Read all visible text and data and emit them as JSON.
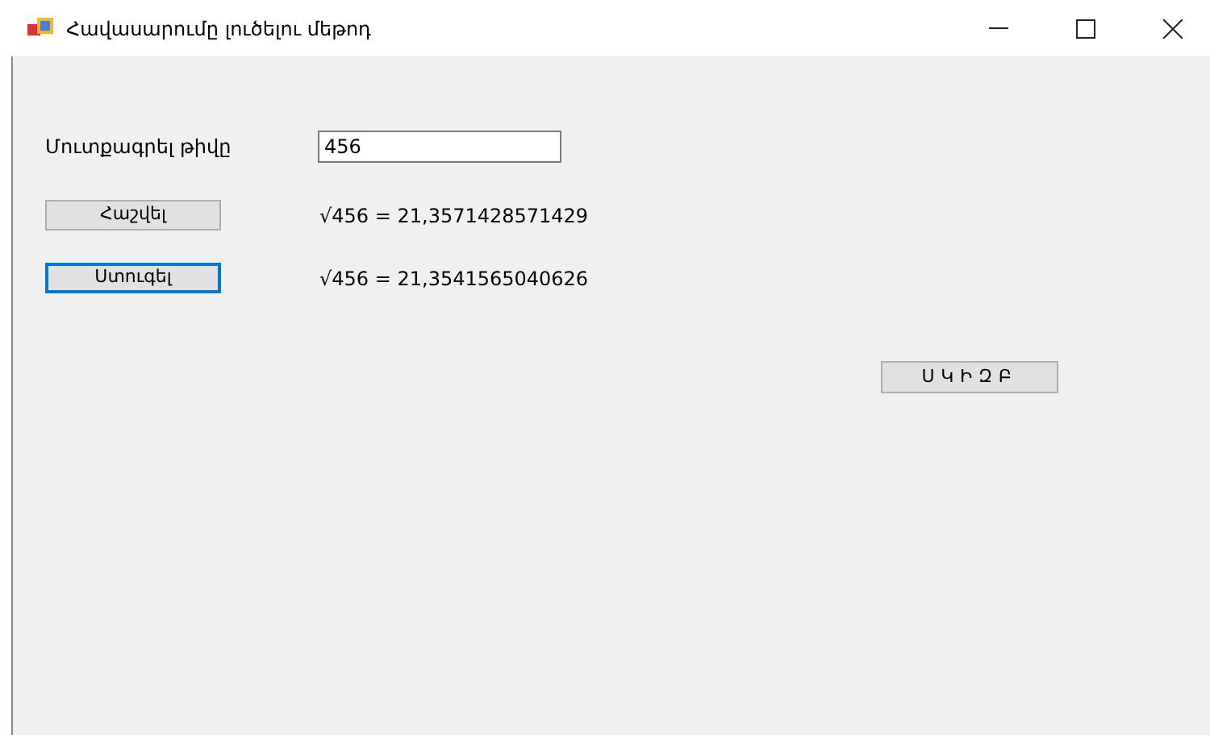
{
  "window": {
    "title": "Հավասարումը լուծելու մեթոդ"
  },
  "input": {
    "label": "Մուտքագրել թիվը",
    "value": "456"
  },
  "rows": [
    {
      "button": "Հաշվել",
      "focused": false,
      "result": "√456 = 21,3571428571429"
    },
    {
      "button": "Ստուգել",
      "focused": true,
      "result": "√456 = 21,3541565040626"
    }
  ],
  "start_button": "ՍԿԻԶԲ"
}
